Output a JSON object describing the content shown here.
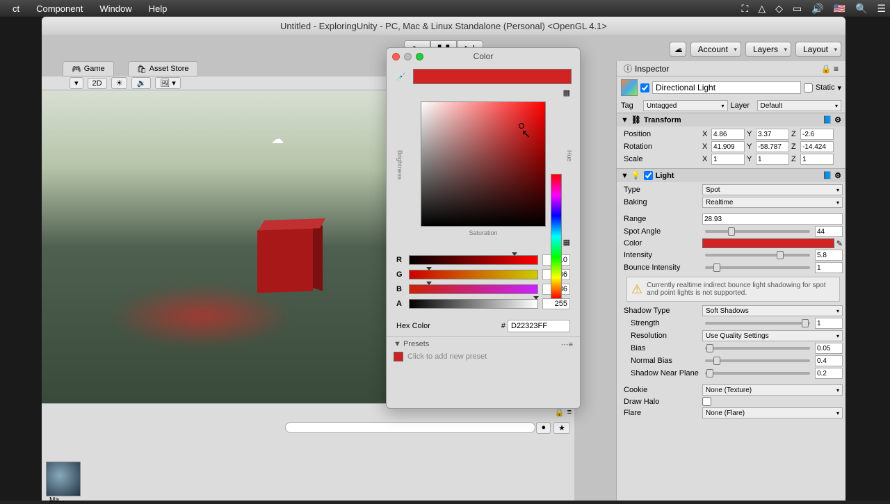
{
  "menubar": {
    "items": [
      "ct",
      "Component",
      "Window",
      "Help"
    ]
  },
  "title": "Untitled - ExploringUnity - PC, Mac & Linux Standalone (Personal) <OpenGL 4.1>",
  "topdrops": {
    "account": "Account",
    "layers": "Layers",
    "layout": "Layout"
  },
  "viewtabs": {
    "game": "Game",
    "assetstore": "Asset Store"
  },
  "scenebar": {
    "btn2d": "2D"
  },
  "inspector": {
    "title": "Inspector",
    "objectname": "Directional Light",
    "static": "Static",
    "taglbl": "Tag",
    "tagval": "Untagged",
    "layerlbl": "Layer",
    "layerval": "Default",
    "transform": {
      "title": "Transform",
      "position": "Position",
      "px": "4.86",
      "py": "3.37",
      "pz": "-2.6",
      "rotation": "Rotation",
      "rx": "41.909",
      "ry": "-58.787",
      "rz": "-14.424",
      "scale": "Scale",
      "sx": "1",
      "sy": "1",
      "sz": "1"
    },
    "light": {
      "title": "Light",
      "type": "Type",
      "typeval": "Spot",
      "baking": "Baking",
      "bakingval": "Realtime",
      "range": "Range",
      "rangeval": "28.93",
      "spotangle": "Spot Angle",
      "spotangleval": "44",
      "color": "Color",
      "intensity": "Intensity",
      "intensityval": "5.8",
      "bounce": "Bounce Intensity",
      "bounceval": "1",
      "warning": "Currently realtime indirect bounce light shadowing for spot and point lights is not supported.",
      "shadowtype": "Shadow Type",
      "shadowtypeval": "Soft Shadows",
      "strength": "Strength",
      "strengthval": "1",
      "resolution": "Resolution",
      "resolutionval": "Use Quality Settings",
      "bias": "Bias",
      "biasval": "0.05",
      "normalbias": "Normal Bias",
      "normalbiasval": "0.4",
      "nearplane": "Shadow Near Plane",
      "nearplaneval": "0.2",
      "cookie": "Cookie",
      "cookieval": "None (Texture)",
      "drawhalo": "Draw Halo",
      "flare": "Flare",
      "flareval": "None (Flare)"
    }
  },
  "colorpicker": {
    "title": "Color",
    "saturation": "Saturation",
    "brightness": "Brightness",
    "hue": "Hue",
    "r": "R",
    "rval": "210",
    "g": "G",
    "gval": "36",
    "b": "B",
    "bval": "36",
    "a": "A",
    "aval": "255",
    "hexlbl": "Hex Color",
    "hexhash": "#",
    "hexval": "D22323FF",
    "presets": "Presets",
    "addpreset": "Click to add new preset"
  },
  "bottom": {
    "thumblbl": "Ma..."
  }
}
